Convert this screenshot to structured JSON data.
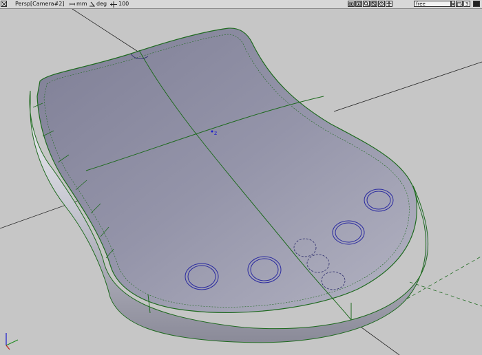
{
  "toolbar": {
    "viewport_title": "Persp[Camera#2]",
    "unit_length": "mm",
    "unit_angle": "deg",
    "unit_scale": "100",
    "view_mode": "free",
    "small_value": "3",
    "icons": [
      "camera-icon",
      "zoom-window-icon",
      "zoom-icon",
      "zoom-extents-icon",
      "orbit-icon",
      "pan-icon"
    ]
  },
  "viewport": {
    "background_color": "#c6c6c6",
    "model_color": "#8f8fa4",
    "edge_color": "#1e6a1e",
    "axis_label": "z"
  }
}
